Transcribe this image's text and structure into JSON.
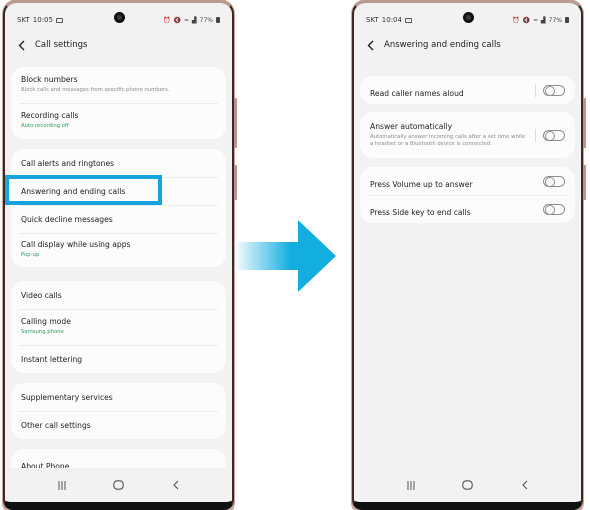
{
  "colors": {
    "highlight": "#17a3dd",
    "arrow": "#12aee0",
    "subtitle_green": "#2a9a5a",
    "background": "#f2f2f2",
    "card": "#fcfcfc"
  },
  "left_screen": {
    "status": {
      "carrier": "SKT",
      "time": "10:05",
      "icons": [
        "gallery-icon",
        "alarm-icon",
        "mute-icon",
        "wifi-icon",
        "signal-icon"
      ],
      "battery": "77%"
    },
    "header": {
      "back_icon": "back-arrow-icon",
      "title": "Call settings"
    },
    "groups": [
      {
        "items": [
          {
            "title": "Block numbers",
            "subtitle": "Block calls and messages from specific phone numbers.",
            "subtitle_style": "gray"
          },
          {
            "title": "Recording calls",
            "subtitle": "Auto recording off",
            "subtitle_style": "green"
          }
        ]
      },
      {
        "items": [
          {
            "title": "Call alerts and ringtones"
          },
          {
            "title": "Answering and ending calls",
            "highlighted": true
          },
          {
            "title": "Quick decline messages"
          },
          {
            "title": "Call display while using apps",
            "subtitle": "Pop-up",
            "subtitle_style": "green"
          }
        ]
      },
      {
        "items": [
          {
            "title": "Video calls"
          },
          {
            "title": "Calling mode",
            "subtitle": "Samsung phone",
            "subtitle_style": "green"
          },
          {
            "title": "Instant lettering"
          }
        ]
      },
      {
        "items": [
          {
            "title": "Supplementary services"
          },
          {
            "title": "Other call settings"
          }
        ]
      },
      {
        "items": [
          {
            "title": "About Phone"
          }
        ]
      }
    ],
    "navbar": {
      "recents": "recents-icon",
      "home": "home-icon",
      "back": "back-icon"
    }
  },
  "right_screen": {
    "status": {
      "carrier": "SKT",
      "time": "10:04",
      "icons": [
        "gallery-icon",
        "alarm-icon",
        "mute-icon",
        "wifi-icon",
        "signal-icon"
      ],
      "battery": "77%"
    },
    "header": {
      "back_icon": "back-arrow-icon",
      "title": "Answering and ending calls"
    },
    "groups": [
      {
        "items": [
          {
            "title": "Read caller names aloud",
            "toggle": false,
            "has_divider": true
          }
        ]
      },
      {
        "items": [
          {
            "title": "Answer automatically",
            "subtitle": "Automatically answer incoming calls after a set time while a headset or a Bluetooth device is connected.",
            "toggle": false,
            "has_divider": true
          }
        ]
      },
      {
        "items": [
          {
            "title": "Press Volume up to answer",
            "toggle": false
          },
          {
            "title": "Press Side key to end calls",
            "toggle": false
          }
        ]
      }
    ],
    "navbar": {
      "recents": "recents-icon",
      "home": "home-icon",
      "back": "back-icon"
    }
  },
  "transition_arrow": {
    "direction": "right",
    "meaning": "navigates-to"
  }
}
